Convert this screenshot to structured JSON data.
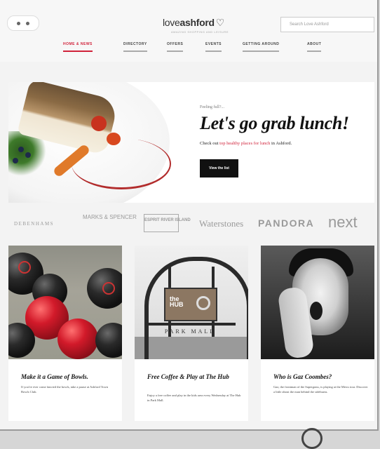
{
  "header": {
    "logo_light": "love",
    "logo_bold": "ashford",
    "logo_heart": "♡",
    "tagline": "AMAZING SHOPPING AND LEISURE",
    "search_placeholder": "Search Love Ashford"
  },
  "nav": {
    "items": [
      {
        "label": "HOME & NEWS",
        "active": true
      },
      {
        "label": "DIRECTORY",
        "active": false
      },
      {
        "label": "OFFERS",
        "active": false
      },
      {
        "label": "EVENTS",
        "active": false
      },
      {
        "label": "GETTING AROUND",
        "active": false
      },
      {
        "label": "ABOUT",
        "active": false
      }
    ]
  },
  "hero": {
    "kicker": "Feeling full?...",
    "title": "Let's go grab lunch!",
    "subtitle_prefix": "Check out ",
    "subtitle_highlight": "top healthy places for lunch",
    "subtitle_suffix": " in Ashford.",
    "button_label": "View the list"
  },
  "brands": [
    "DEBENHAMS",
    "MARKS & SPENCER",
    "ESPRIT RIVER ISLAND",
    "Waterstones",
    "PANDORA",
    "next"
  ],
  "cards": [
    {
      "title": "Make it a Game of Bowls.",
      "description": "If you've ever come fancied the bowls, take a pause at Ashford Town Bowls Club."
    },
    {
      "title": "Free Coffee & Play at The Hub",
      "description": "Enjoy a free coffee and play in the kids area every Wednesday at The Hub in Park Mall."
    },
    {
      "title": "Who is Gaz Coombes?",
      "description": "Gaz, the frontman of the Supergrass, is playing at the Mews tour. Discover a little about the man behind the sideburns."
    }
  ],
  "colors": {
    "accent": "#d0223a",
    "text": "#111111",
    "button": "#111111"
  }
}
